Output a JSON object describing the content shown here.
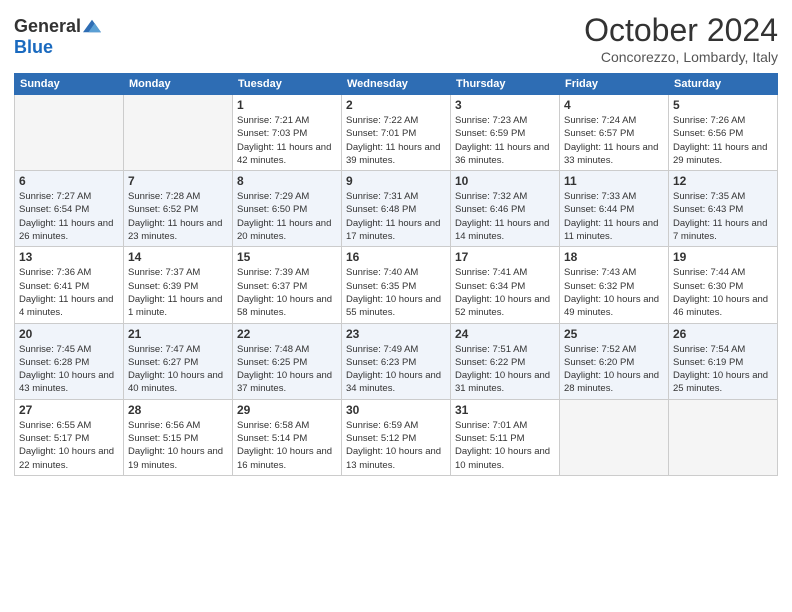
{
  "header": {
    "logo_general": "General",
    "logo_blue": "Blue",
    "month": "October 2024",
    "location": "Concorezzo, Lombardy, Italy"
  },
  "days_of_week": [
    "Sunday",
    "Monday",
    "Tuesday",
    "Wednesday",
    "Thursday",
    "Friday",
    "Saturday"
  ],
  "weeks": [
    [
      {
        "day": "",
        "sunrise": "",
        "sunset": "",
        "daylight": "",
        "empty": true
      },
      {
        "day": "",
        "sunrise": "",
        "sunset": "",
        "daylight": "",
        "empty": true
      },
      {
        "day": "1",
        "sunrise": "Sunrise: 7:21 AM",
        "sunset": "Sunset: 7:03 PM",
        "daylight": "Daylight: 11 hours and 42 minutes."
      },
      {
        "day": "2",
        "sunrise": "Sunrise: 7:22 AM",
        "sunset": "Sunset: 7:01 PM",
        "daylight": "Daylight: 11 hours and 39 minutes."
      },
      {
        "day": "3",
        "sunrise": "Sunrise: 7:23 AM",
        "sunset": "Sunset: 6:59 PM",
        "daylight": "Daylight: 11 hours and 36 minutes."
      },
      {
        "day": "4",
        "sunrise": "Sunrise: 7:24 AM",
        "sunset": "Sunset: 6:57 PM",
        "daylight": "Daylight: 11 hours and 33 minutes."
      },
      {
        "day": "5",
        "sunrise": "Sunrise: 7:26 AM",
        "sunset": "Sunset: 6:56 PM",
        "daylight": "Daylight: 11 hours and 29 minutes."
      }
    ],
    [
      {
        "day": "6",
        "sunrise": "Sunrise: 7:27 AM",
        "sunset": "Sunset: 6:54 PM",
        "daylight": "Daylight: 11 hours and 26 minutes."
      },
      {
        "day": "7",
        "sunrise": "Sunrise: 7:28 AM",
        "sunset": "Sunset: 6:52 PM",
        "daylight": "Daylight: 11 hours and 23 minutes."
      },
      {
        "day": "8",
        "sunrise": "Sunrise: 7:29 AM",
        "sunset": "Sunset: 6:50 PM",
        "daylight": "Daylight: 11 hours and 20 minutes."
      },
      {
        "day": "9",
        "sunrise": "Sunrise: 7:31 AM",
        "sunset": "Sunset: 6:48 PM",
        "daylight": "Daylight: 11 hours and 17 minutes."
      },
      {
        "day": "10",
        "sunrise": "Sunrise: 7:32 AM",
        "sunset": "Sunset: 6:46 PM",
        "daylight": "Daylight: 11 hours and 14 minutes."
      },
      {
        "day": "11",
        "sunrise": "Sunrise: 7:33 AM",
        "sunset": "Sunset: 6:44 PM",
        "daylight": "Daylight: 11 hours and 11 minutes."
      },
      {
        "day": "12",
        "sunrise": "Sunrise: 7:35 AM",
        "sunset": "Sunset: 6:43 PM",
        "daylight": "Daylight: 11 hours and 7 minutes."
      }
    ],
    [
      {
        "day": "13",
        "sunrise": "Sunrise: 7:36 AM",
        "sunset": "Sunset: 6:41 PM",
        "daylight": "Daylight: 11 hours and 4 minutes."
      },
      {
        "day": "14",
        "sunrise": "Sunrise: 7:37 AM",
        "sunset": "Sunset: 6:39 PM",
        "daylight": "Daylight: 11 hours and 1 minute."
      },
      {
        "day": "15",
        "sunrise": "Sunrise: 7:39 AM",
        "sunset": "Sunset: 6:37 PM",
        "daylight": "Daylight: 10 hours and 58 minutes."
      },
      {
        "day": "16",
        "sunrise": "Sunrise: 7:40 AM",
        "sunset": "Sunset: 6:35 PM",
        "daylight": "Daylight: 10 hours and 55 minutes."
      },
      {
        "day": "17",
        "sunrise": "Sunrise: 7:41 AM",
        "sunset": "Sunset: 6:34 PM",
        "daylight": "Daylight: 10 hours and 52 minutes."
      },
      {
        "day": "18",
        "sunrise": "Sunrise: 7:43 AM",
        "sunset": "Sunset: 6:32 PM",
        "daylight": "Daylight: 10 hours and 49 minutes."
      },
      {
        "day": "19",
        "sunrise": "Sunrise: 7:44 AM",
        "sunset": "Sunset: 6:30 PM",
        "daylight": "Daylight: 10 hours and 46 minutes."
      }
    ],
    [
      {
        "day": "20",
        "sunrise": "Sunrise: 7:45 AM",
        "sunset": "Sunset: 6:28 PM",
        "daylight": "Daylight: 10 hours and 43 minutes."
      },
      {
        "day": "21",
        "sunrise": "Sunrise: 7:47 AM",
        "sunset": "Sunset: 6:27 PM",
        "daylight": "Daylight: 10 hours and 40 minutes."
      },
      {
        "day": "22",
        "sunrise": "Sunrise: 7:48 AM",
        "sunset": "Sunset: 6:25 PM",
        "daylight": "Daylight: 10 hours and 37 minutes."
      },
      {
        "day": "23",
        "sunrise": "Sunrise: 7:49 AM",
        "sunset": "Sunset: 6:23 PM",
        "daylight": "Daylight: 10 hours and 34 minutes."
      },
      {
        "day": "24",
        "sunrise": "Sunrise: 7:51 AM",
        "sunset": "Sunset: 6:22 PM",
        "daylight": "Daylight: 10 hours and 31 minutes."
      },
      {
        "day": "25",
        "sunrise": "Sunrise: 7:52 AM",
        "sunset": "Sunset: 6:20 PM",
        "daylight": "Daylight: 10 hours and 28 minutes."
      },
      {
        "day": "26",
        "sunrise": "Sunrise: 7:54 AM",
        "sunset": "Sunset: 6:19 PM",
        "daylight": "Daylight: 10 hours and 25 minutes."
      }
    ],
    [
      {
        "day": "27",
        "sunrise": "Sunrise: 6:55 AM",
        "sunset": "Sunset: 5:17 PM",
        "daylight": "Daylight: 10 hours and 22 minutes."
      },
      {
        "day": "28",
        "sunrise": "Sunrise: 6:56 AM",
        "sunset": "Sunset: 5:15 PM",
        "daylight": "Daylight: 10 hours and 19 minutes."
      },
      {
        "day": "29",
        "sunrise": "Sunrise: 6:58 AM",
        "sunset": "Sunset: 5:14 PM",
        "daylight": "Daylight: 10 hours and 16 minutes."
      },
      {
        "day": "30",
        "sunrise": "Sunrise: 6:59 AM",
        "sunset": "Sunset: 5:12 PM",
        "daylight": "Daylight: 10 hours and 13 minutes."
      },
      {
        "day": "31",
        "sunrise": "Sunrise: 7:01 AM",
        "sunset": "Sunset: 5:11 PM",
        "daylight": "Daylight: 10 hours and 10 minutes."
      },
      {
        "day": "",
        "sunrise": "",
        "sunset": "",
        "daylight": "",
        "empty": true
      },
      {
        "day": "",
        "sunrise": "",
        "sunset": "",
        "daylight": "",
        "empty": true
      }
    ]
  ]
}
